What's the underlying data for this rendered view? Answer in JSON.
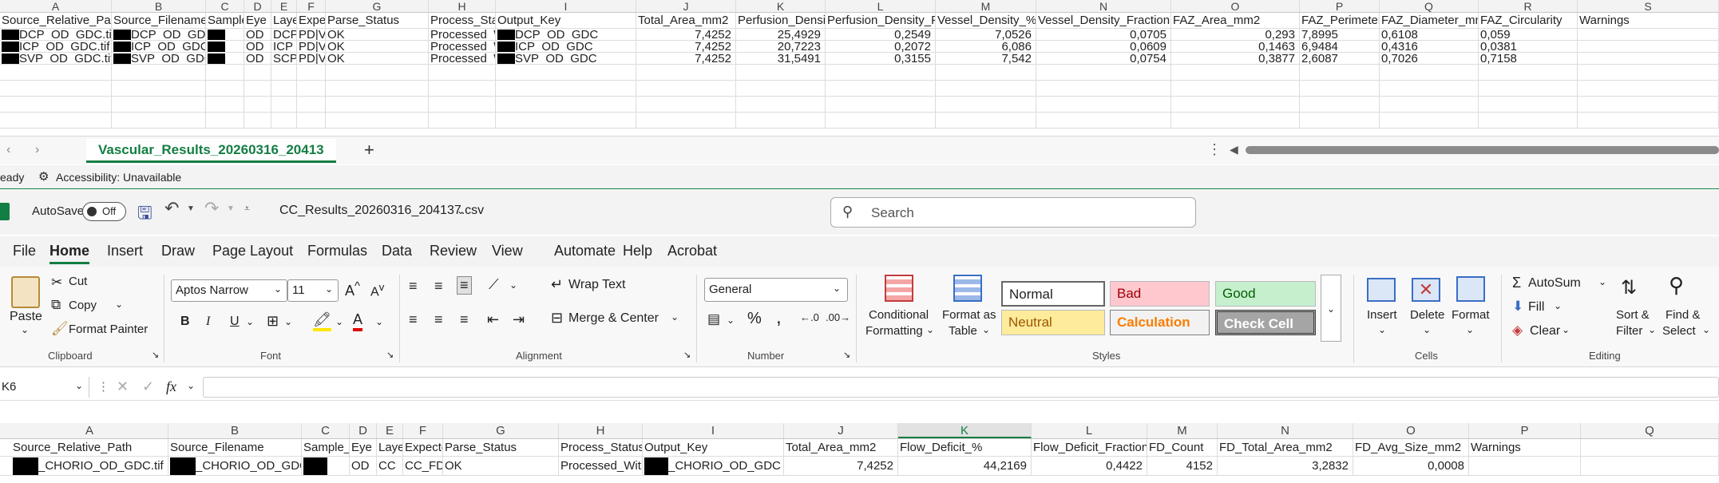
{
  "top_sheet": {
    "col_letters": [
      "A",
      "B",
      "C",
      "D",
      "E",
      "F",
      "G",
      "H",
      "I",
      "J",
      "K",
      "L",
      "M",
      "N",
      "O",
      "P",
      "Q",
      "R",
      "S"
    ],
    "headers": [
      "Source_Relative_Path",
      "Source_Filename",
      "Sample_ID",
      "Eye",
      "Layer",
      "Expected_Analyses",
      "Parse_Status",
      "Process_Status",
      "Output_Key",
      "Total_Area_mm2",
      "Perfusion_Density_%",
      "Perfusion_Density_Fraction",
      "Vessel_Density_%",
      "Vessel_Density_Fraction",
      "FAZ_Area_mm2",
      "FAZ_Perimeter_mm",
      "FAZ_Diameter_mm",
      "FAZ_Circularity",
      "Warnings"
    ],
    "rows": [
      [
        "DCP_OD_GDC.tif",
        "DCP_OD_GDC",
        "",
        "OD",
        "DCP",
        "PD|VD|FAZ",
        "OK",
        "Processed_With_Warnings",
        "DCP_OD_GDC",
        "7,4252",
        "25,4929",
        "0,2549",
        "7,0526",
        "0,0705",
        "0,293",
        "7,8995",
        "0,6108",
        "0,059",
        ""
      ],
      [
        "ICP_OD_GDC.tif",
        "ICP_OD_GDC",
        "",
        "OD",
        "ICP",
        "PD|VD|FAZ",
        "OK",
        "Processed_With_Warnings",
        "ICP_OD_GDC",
        "7,4252",
        "20,7223",
        "0,2072",
        "6,086",
        "0,0609",
        "0,1463",
        "6,9484",
        "0,4316",
        "0,0381",
        ""
      ],
      [
        "SVP_OD_GDC.tif",
        "SVP_OD_GDC",
        "",
        "OD",
        "SCP",
        "PD|VD|FAZ",
        "OK",
        "Processed_With_Warnings",
        "SVP_OD_GDC",
        "7,4252",
        "31,5491",
        "0,3155",
        "7,542",
        "0,0754",
        "0,3877",
        "2,6087",
        "0,7026",
        "0,7158",
        ""
      ]
    ],
    "sheet_tab": "Vascular_Results_20260316_20413",
    "add_sheet": "+",
    "status_ready": "eady",
    "status_accessibility": "Accessibility: Unavailable"
  },
  "window": {
    "autosave_label": "AutoSave",
    "autosave_state": "Off",
    "filename": "CC_Results_20260316_204137.csv",
    "search_placeholder": "Search"
  },
  "menu": [
    "File",
    "Home",
    "Insert",
    "Draw",
    "Page Layout",
    "Formulas",
    "Data",
    "Review",
    "View",
    "Automate",
    "Help",
    "Acrobat"
  ],
  "ribbon": {
    "paste": "Paste",
    "cut": "Cut",
    "copy": "Copy",
    "format_painter": "Format Painter",
    "clipboard_group": "Clipboard",
    "font_name": "Aptos Narrow",
    "font_size": "11",
    "font_group": "Font",
    "wrap_text": "Wrap Text",
    "merge_center": "Merge & Center",
    "alignment_group": "Alignment",
    "number_format": "General",
    "number_group": "Number",
    "cond_fmt_1": "Conditional",
    "cond_fmt_2": "Formatting",
    "fmt_table_1": "Format as",
    "fmt_table_2": "Table",
    "styles": {
      "normal": "Normal",
      "bad": "Bad",
      "good": "Good",
      "neutral": "Neutral",
      "calculation": "Calculation",
      "check_cell": "Check Cell"
    },
    "styles_group": "Styles",
    "insert": "Insert",
    "delete": "Delete",
    "format": "Format",
    "cells_group": "Cells",
    "autosum": "AutoSum",
    "fill": "Fill",
    "clear": "Clear",
    "sort_filter_1": "Sort &",
    "sort_filter_2": "Filter",
    "find_select_1": "Find &",
    "find_select_2": "Select",
    "editing_group": "Editing",
    "bold": "B",
    "italic": "I",
    "underline": "U"
  },
  "formula_bar": {
    "name_box": "K6",
    "fx": "fx",
    "value": ""
  },
  "bottom_sheet": {
    "col_letters": [
      "A",
      "B",
      "C",
      "D",
      "E",
      "F",
      "G",
      "H",
      "I",
      "J",
      "K",
      "L",
      "M",
      "N",
      "O",
      "P",
      "Q"
    ],
    "headers": [
      "Source_Relative_Path",
      "Source_Filename",
      "Sample_ID",
      "Eye",
      "Layer",
      "Expected_Analyses",
      "Parse_Status",
      "Process_Status",
      "Output_Key",
      "Total_Area_mm2",
      "Flow_Deficit_%",
      "Flow_Deficit_Fraction",
      "FD_Count",
      "FD_Total_Area_mm2",
      "FD_Avg_Size_mm2",
      "Warnings",
      ""
    ],
    "rows": [
      [
        "_CHORIO_OD_GDC.tif",
        "_CHORIO_OD_GDC",
        "",
        "OD",
        "CC",
        "CC_FD",
        "OK",
        "Processed_With_Warnings",
        "_CHORIO_OD_GDC",
        "7,4252",
        "44,2169",
        "0,4422",
        "4152",
        "3,2832",
        "0,0008",
        "",
        ""
      ]
    ]
  },
  "colors": {
    "excel_green": "#137e43",
    "bad_bg": "#ffc7ce",
    "bad_fg": "#9c0006",
    "good_bg": "#c6efce",
    "good_fg": "#006100",
    "neutral_bg": "#ffeb9c",
    "neutral_fg": "#9c5700",
    "calc_fg": "#fa7d00",
    "check_bg": "#a5a5a5"
  }
}
